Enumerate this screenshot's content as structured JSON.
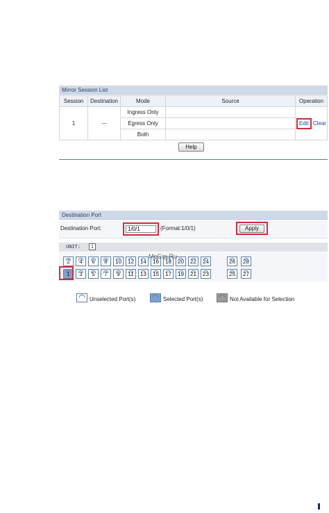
{
  "mirror_session_list": {
    "title": "Mirror Session List",
    "columns": [
      "Session",
      "Destination",
      "Mode",
      "Source",
      "Operation"
    ],
    "row": {
      "session": "1",
      "destination": "---",
      "modes": [
        "Ingress Only",
        "Egress Only",
        "Both"
      ],
      "source": "",
      "edit_label": "Edit",
      "clear_label": "Clear"
    },
    "help_label": "Help"
  },
  "destination_port": {
    "title": "Destination Port",
    "field_label": "Destination Port:",
    "value": "1/0/1",
    "format_hint": "(Format:1/0/1)",
    "apply_label": "Apply"
  },
  "unit_bar": {
    "label": "UNIT:",
    "selected_unit": "1"
  },
  "ports": {
    "top_row": [
      "2",
      "4",
      "6",
      "8",
      "10",
      "12",
      "14",
      "16",
      "18",
      "20",
      "22",
      "24",
      "26",
      "28"
    ],
    "bottom_row": [
      "1",
      "3",
      "5",
      "7",
      "9",
      "11",
      "13",
      "15",
      "17",
      "19",
      "21",
      "23",
      "25",
      "27"
    ],
    "selected": [
      "1"
    ]
  },
  "watermark": "McGrp.Ru",
  "legend": {
    "unselected": "Unselected Port(s)",
    "selected": "Selected Port(s)",
    "not_available": "Not Available for Selection"
  },
  "colors": {
    "header_bg": "#cfd9e8",
    "highlight_frame": "#d42a3c",
    "selected_port": "#7fa2cb",
    "link": "#1a47a8"
  }
}
